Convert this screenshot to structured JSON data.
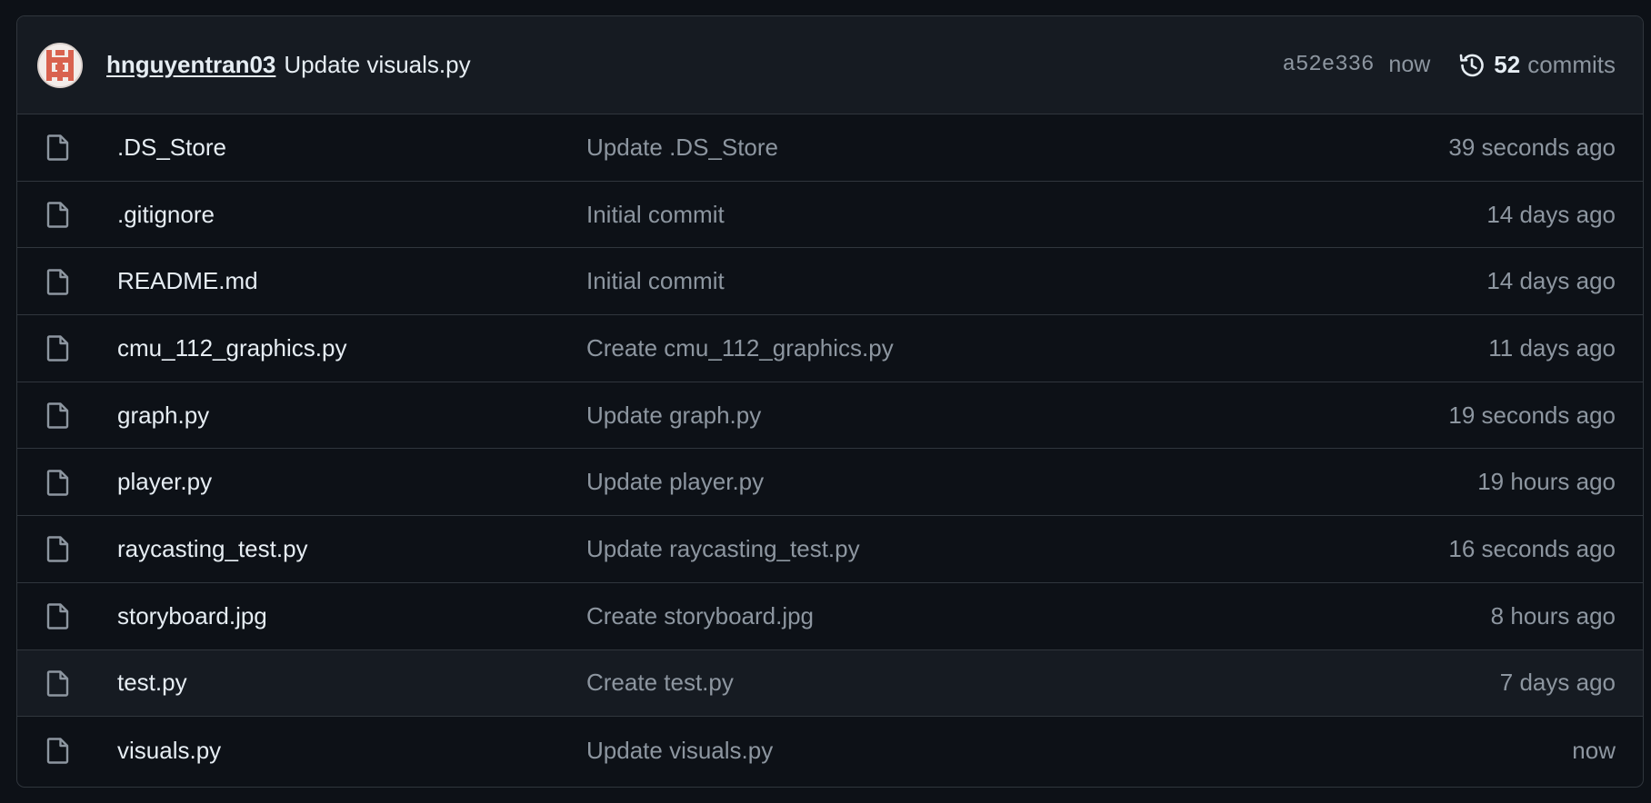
{
  "latest_commit": {
    "author": "hnguyentran03",
    "message": "Update visuals.py",
    "sha": "a52e336",
    "time": "now",
    "commit_count": "52",
    "commit_count_label": "commits"
  },
  "files": [
    {
      "name": ".DS_Store",
      "commit_message": "Update .DS_Store",
      "age": "39 seconds ago",
      "icon": "file-icon"
    },
    {
      "name": ".gitignore",
      "commit_message": "Initial commit",
      "age": "14 days ago",
      "icon": "file-icon"
    },
    {
      "name": "README.md",
      "commit_message": "Initial commit",
      "age": "14 days ago",
      "icon": "file-icon"
    },
    {
      "name": "cmu_112_graphics.py",
      "commit_message": "Create cmu_112_graphics.py",
      "age": "11 days ago",
      "icon": "file-icon"
    },
    {
      "name": "graph.py",
      "commit_message": "Update graph.py",
      "age": "19 seconds ago",
      "icon": "file-icon"
    },
    {
      "name": "player.py",
      "commit_message": "Update player.py",
      "age": "19 hours ago",
      "icon": "file-icon"
    },
    {
      "name": "raycasting_test.py",
      "commit_message": "Update raycasting_test.py",
      "age": "16 seconds ago",
      "icon": "file-icon"
    },
    {
      "name": "storyboard.jpg",
      "commit_message": "Create storyboard.jpg",
      "age": "8 hours ago",
      "icon": "file-icon"
    },
    {
      "name": "test.py",
      "commit_message": "Create test.py",
      "age": "7 days ago",
      "icon": "file-icon"
    },
    {
      "name": "visuals.py",
      "commit_message": "Update visuals.py",
      "age": "now",
      "icon": "file-icon"
    }
  ],
  "colors": {
    "background": "#0d1117",
    "header_background": "#161b22",
    "border": "#30363d",
    "text_primary": "#e6edf3",
    "text_muted": "#8d96a0",
    "avatar_accent": "#d9624f"
  }
}
